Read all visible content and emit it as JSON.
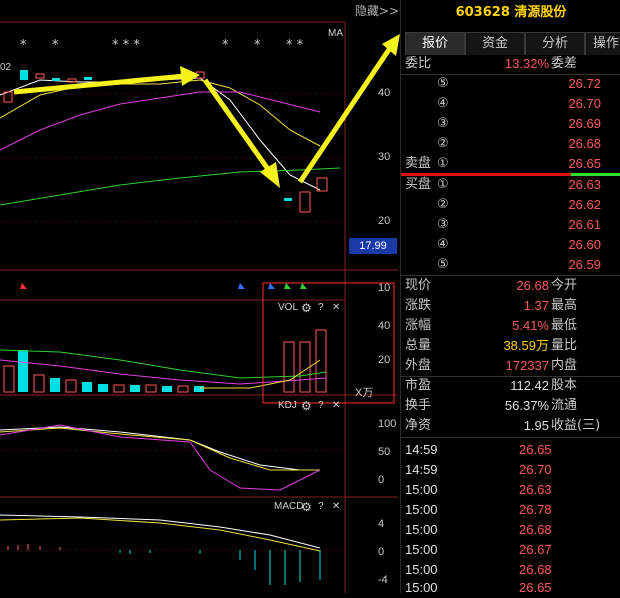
{
  "chart_area": {
    "hide_label": "隐藏>>",
    "ma_label": "MA",
    "price_axis": [
      "40",
      "30",
      "20"
    ],
    "price_tag": "17.99",
    "vol_axis": [
      "10",
      "40",
      "20"
    ],
    "vol_unit": "X万",
    "kdj_axis": [
      "100",
      "50",
      "0"
    ],
    "macd_axis": [
      "4",
      "0",
      "-4"
    ],
    "vol_label": "VOL",
    "kdj_label": "KDJ",
    "macd_label": "MACD",
    "gear_icon": "gear-icon",
    "help_mark": "?",
    "close_mark": "✕",
    "left_cut_label": "02",
    "stars": [
      "*",
      "*",
      "* * *",
      "*",
      "*",
      "* *"
    ]
  },
  "stock": {
    "code": "603628",
    "name": "清源股份",
    "title": "603628 清源股份"
  },
  "tabs": [
    {
      "label": "报价"
    },
    {
      "label": "资金"
    },
    {
      "label": "分析"
    },
    {
      "label": "操作"
    }
  ],
  "ratio": {
    "label": "委比",
    "value": "13.32%",
    "label2": "委差"
  },
  "sell": [
    {
      "label": "",
      "level": "⑤",
      "price": "26.72"
    },
    {
      "label": "",
      "level": "④",
      "price": "26.70"
    },
    {
      "label": "",
      "level": "③",
      "price": "26.69"
    },
    {
      "label": "",
      "level": "②",
      "price": "26.68"
    },
    {
      "label": "卖盘",
      "level": "①",
      "price": "26.65"
    }
  ],
  "buy": [
    {
      "label": "买盘",
      "level": "①",
      "price": "26.63"
    },
    {
      "label": "",
      "level": "②",
      "price": "26.62"
    },
    {
      "label": "",
      "level": "③",
      "price": "26.61"
    },
    {
      "label": "",
      "level": "④",
      "price": "26.60"
    },
    {
      "label": "",
      "level": "⑤",
      "price": "26.59"
    }
  ],
  "quote": [
    {
      "l": "现价",
      "v": "26.68",
      "r": "今开"
    },
    {
      "l": "涨跌",
      "v": "1.37",
      "r": "最高"
    },
    {
      "l": "涨幅",
      "v": "5.41%",
      "r": "最低"
    },
    {
      "l": "总量",
      "v": "38.59万",
      "r": "量比"
    },
    {
      "l": "外盘",
      "v": "172337",
      "r": "内盘"
    }
  ],
  "fund": [
    {
      "l": "市盈",
      "v": "112.42",
      "r": "股本"
    },
    {
      "l": "换手",
      "v": "56.37%",
      "r": "流通"
    },
    {
      "l": "净资",
      "v": "1.95",
      "r": "收益(三)"
    }
  ],
  "ticks": [
    {
      "time": "14:59",
      "price": "26.65"
    },
    {
      "time": "14:59",
      "price": "26.70"
    },
    {
      "time": "15:00",
      "price": "26.63"
    },
    {
      "time": "15:00",
      "price": "26.78"
    },
    {
      "time": "15:00",
      "price": "26.68"
    },
    {
      "time": "15:00",
      "price": "26.67"
    },
    {
      "time": "15:00",
      "price": "26.68"
    },
    {
      "time": "15:00",
      "price": "26.65"
    }
  ],
  "colors": {
    "up": "#ff5a5a",
    "down": "#00e0e0",
    "accent": "#ffd400",
    "arrow": "#f7f21a"
  }
}
